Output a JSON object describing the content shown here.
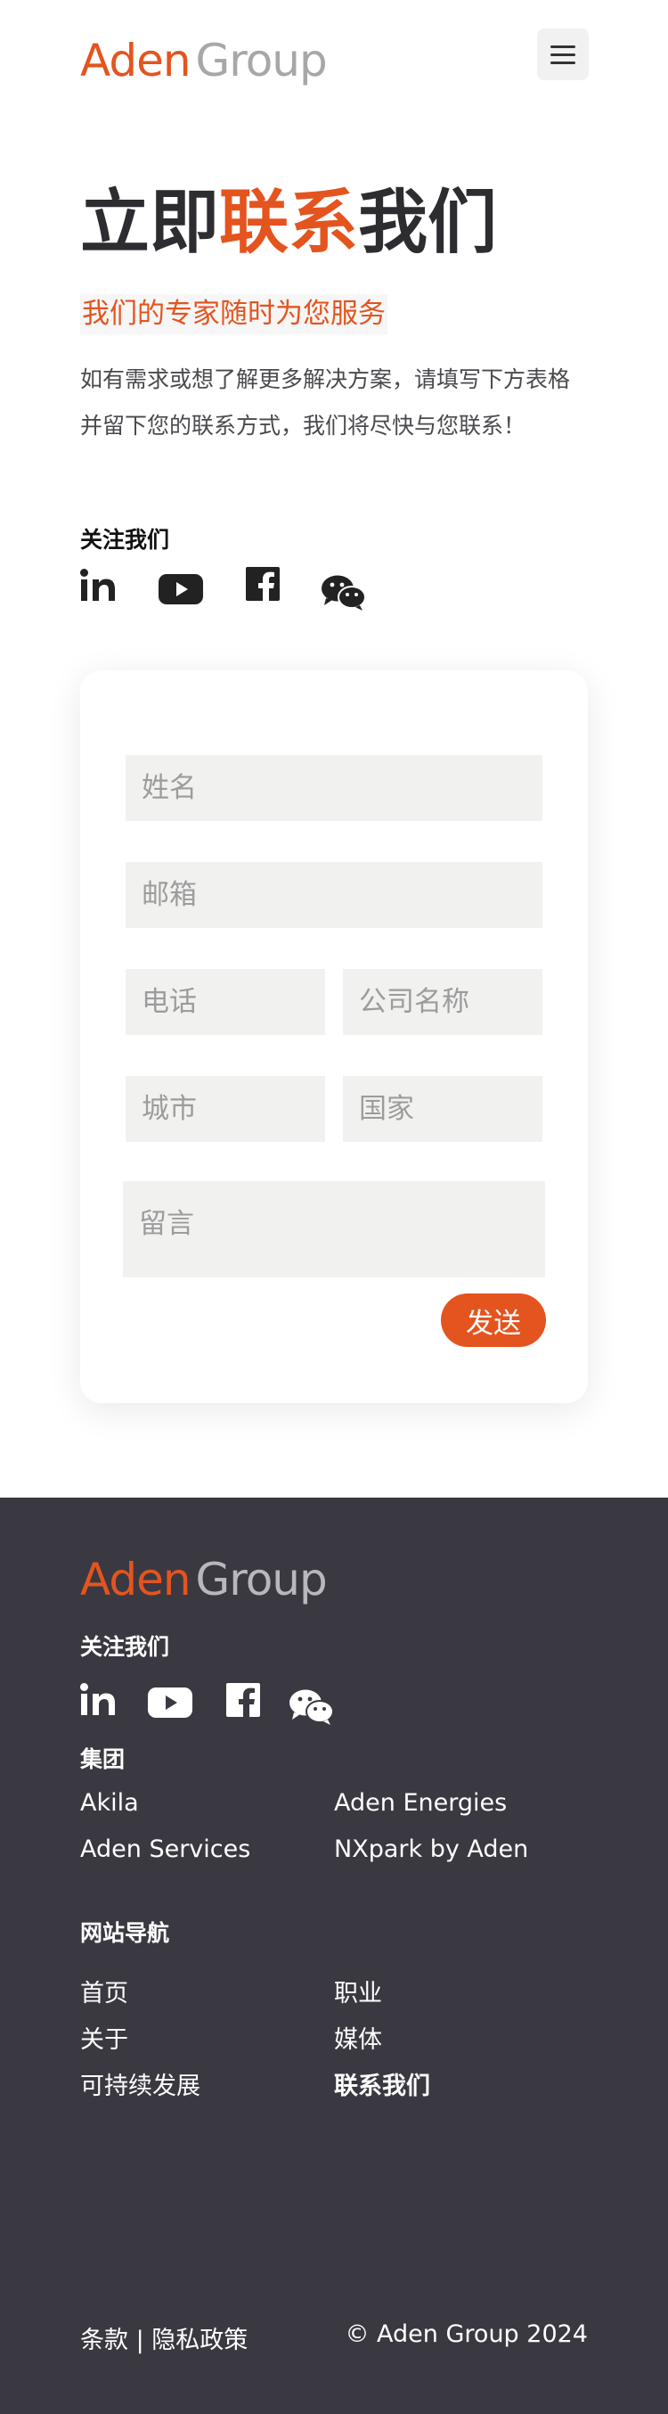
{
  "header": {
    "logo_part1": "Aden",
    "logo_part2": "Group",
    "menu_icon": "hamburger-menu-icon"
  },
  "hero": {
    "title_part1": "立即",
    "title_accent": "联系",
    "title_part2": "我们",
    "subtitle": "我们的专家随时为您服务",
    "intro": "如有需求或想了解更多解决方案，请填写下方表格并留下您的联系方式，我们将尽快与您联系！",
    "follow_label": "关注我们"
  },
  "socials": [
    "linkedin-icon",
    "youtube-icon",
    "facebook-icon",
    "wechat-icon"
  ],
  "form": {
    "name_placeholder": "姓名",
    "email_placeholder": "邮箱",
    "phone_placeholder": "电话",
    "company_placeholder": "公司名称",
    "city_placeholder": "城市",
    "country_placeholder": "国家",
    "message_placeholder": "留言",
    "send_label": "发送"
  },
  "footer": {
    "logo_part1": "Aden",
    "logo_part2": "Group",
    "follow_label": "关注我们",
    "group_heading": "集团",
    "group_links": [
      "Akila",
      "Aden Energies",
      "Aden Services",
      "NXpark by Aden"
    ],
    "nav_heading": "网站导航",
    "nav_links": [
      "首页",
      "职业",
      "关于",
      "媒体",
      "可持续发展",
      "联系我们"
    ],
    "terms": "条款 | 隐私政策",
    "copyright": "© Aden Group 2024"
  },
  "colors": {
    "accent": "#e4541f",
    "footer_bg": "#3a3941",
    "field_bg": "#f1f2f0"
  }
}
